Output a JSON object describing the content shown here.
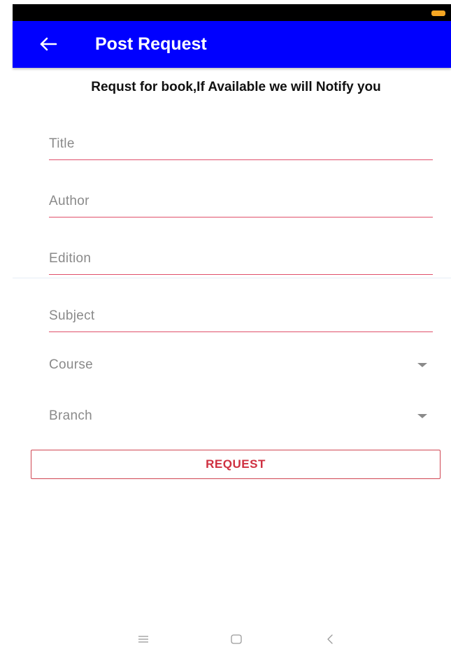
{
  "status_bar": {
    "battery_color": "#f5a623"
  },
  "app_bar": {
    "title": "Post Request",
    "background": "#0000ff",
    "back_icon": "arrow-left-icon"
  },
  "form": {
    "heading": "Requst for book,If Available we will Notify you",
    "fields": {
      "title": {
        "placeholder": "Title",
        "value": ""
      },
      "author": {
        "placeholder": "Author",
        "value": ""
      },
      "edition": {
        "placeholder": "Edition",
        "value": ""
      },
      "subject": {
        "placeholder": "Subject",
        "value": ""
      }
    },
    "dropdowns": {
      "course": {
        "label": "Course",
        "icon": "caret-down-icon"
      },
      "branch": {
        "label": "Branch",
        "icon": "caret-down-icon"
      }
    },
    "accent_color": "#e0506b",
    "submit_label": "REQUEST"
  },
  "nav_bar": {
    "icons": [
      "menu-icon",
      "home-icon",
      "back-icon"
    ]
  }
}
